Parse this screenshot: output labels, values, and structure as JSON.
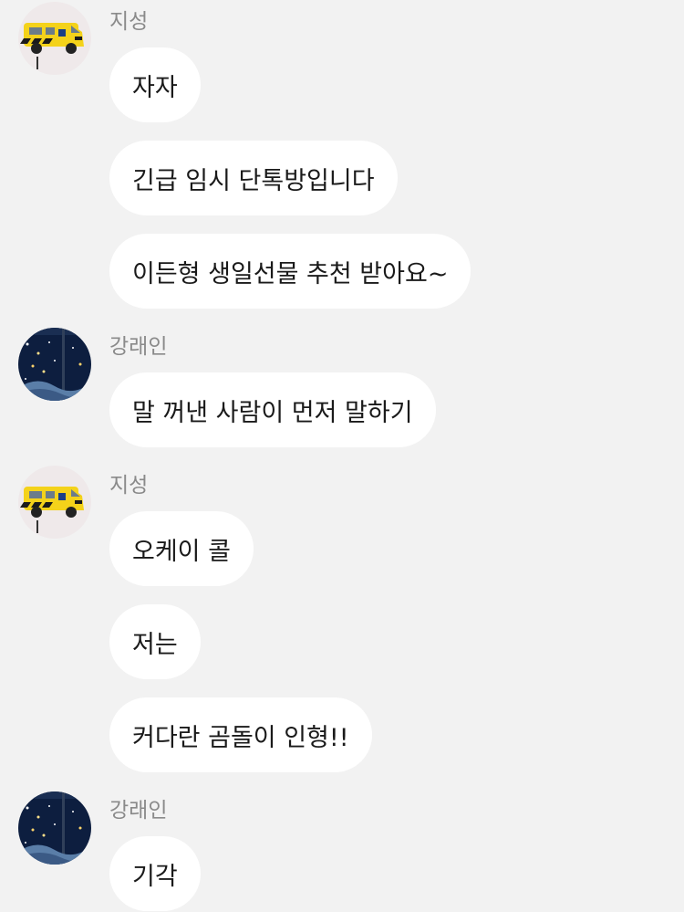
{
  "colors": {
    "background": "#f2f2f2",
    "bubble": "#ffffff",
    "name_text": "#8a8a8a",
    "message_text": "#1a1a1a"
  },
  "messages": [
    {
      "sender": "지성",
      "avatar": "ambulance-avatar-icon",
      "bubbles": [
        "자자",
        "긴급 임시 단톡방입니다",
        "이든형 생일선물 추천 받아요~"
      ]
    },
    {
      "sender": "강래인",
      "avatar": "night-sky-avatar-icon",
      "bubbles": [
        "말 꺼낸 사람이 먼저 말하기"
      ]
    },
    {
      "sender": "지성",
      "avatar": "ambulance-avatar-icon",
      "bubbles": [
        "오케이 콜",
        "저는",
        "커다란 곰돌이 인형!!"
      ]
    },
    {
      "sender": "강래인",
      "avatar": "night-sky-avatar-icon",
      "bubbles": [
        "기각"
      ]
    }
  ]
}
